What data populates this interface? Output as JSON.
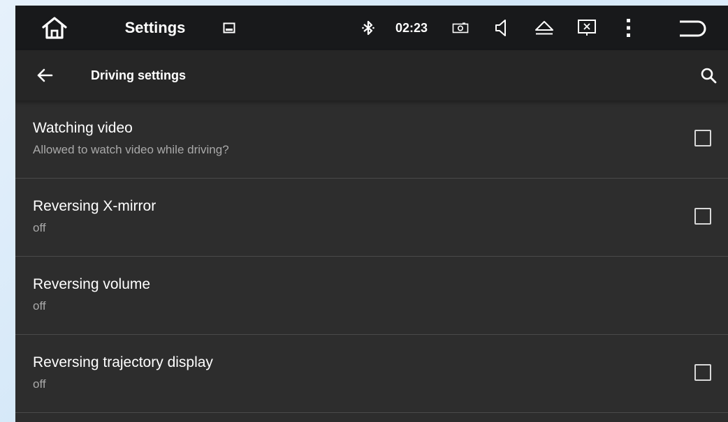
{
  "statusbar": {
    "title": "Settings",
    "time": "02:23",
    "icons": [
      "home-icon",
      "gallery-icon",
      "bluetooth-icon",
      "screenshot-icon",
      "volume-icon",
      "eject-icon",
      "close-window-icon",
      "more-vert-icon",
      "back-return-icon"
    ]
  },
  "toolbar": {
    "title": "Driving settings",
    "icons": [
      "arrow-back-icon",
      "search-icon"
    ]
  },
  "items": [
    {
      "title": "Watching video",
      "subtitle": "Allowed to watch video while driving?",
      "checked": false
    },
    {
      "title": "Reversing X-mirror",
      "subtitle": "off",
      "checked": false
    },
    {
      "title": "Reversing volume",
      "subtitle": "off"
    },
    {
      "title": "Reversing trajectory display",
      "subtitle": "off",
      "checked": false
    }
  ]
}
